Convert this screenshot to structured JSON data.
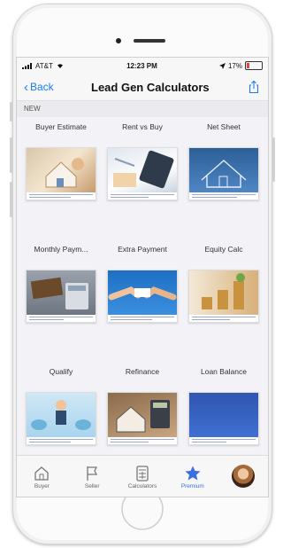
{
  "status_bar": {
    "carrier": "AT&T",
    "time": "12:23 PM",
    "battery": "17%",
    "battery_level": 0.17
  },
  "nav": {
    "back_label": "Back",
    "title": "Lead Gen Calculators"
  },
  "section_label": "NEW",
  "calculators": [
    {
      "label": "Buyer Estimate",
      "icon": "house-model-image"
    },
    {
      "label": "Rent vs Buy",
      "icon": "calculator-keys-image"
    },
    {
      "label": "Net Sheet",
      "icon": "house-blueprint-image"
    },
    {
      "label": "Monthly Paym...",
      "icon": "sign-calculator-image"
    },
    {
      "label": "Extra Payment",
      "icon": "handshake-image"
    },
    {
      "label": "Equity Calc",
      "icon": "coin-stacks-image"
    },
    {
      "label": "Qualify",
      "icon": "businessman-image"
    },
    {
      "label": "Refinance",
      "icon": "house-calculator-image"
    },
    {
      "label": "Loan Balance",
      "icon": "blue-panel-image"
    }
  ],
  "tabs": [
    {
      "label": "Buyer",
      "icon": "house-icon"
    },
    {
      "label": "Seller",
      "icon": "flag-icon"
    },
    {
      "label": "Calculators",
      "icon": "calculator-icon"
    },
    {
      "label": "Premium",
      "icon": "star-icon",
      "active": true
    },
    {
      "label": "",
      "icon": "profile-avatar"
    }
  ],
  "colors": {
    "accent": "#1e7cf0",
    "premium": "#3a6fe0"
  }
}
